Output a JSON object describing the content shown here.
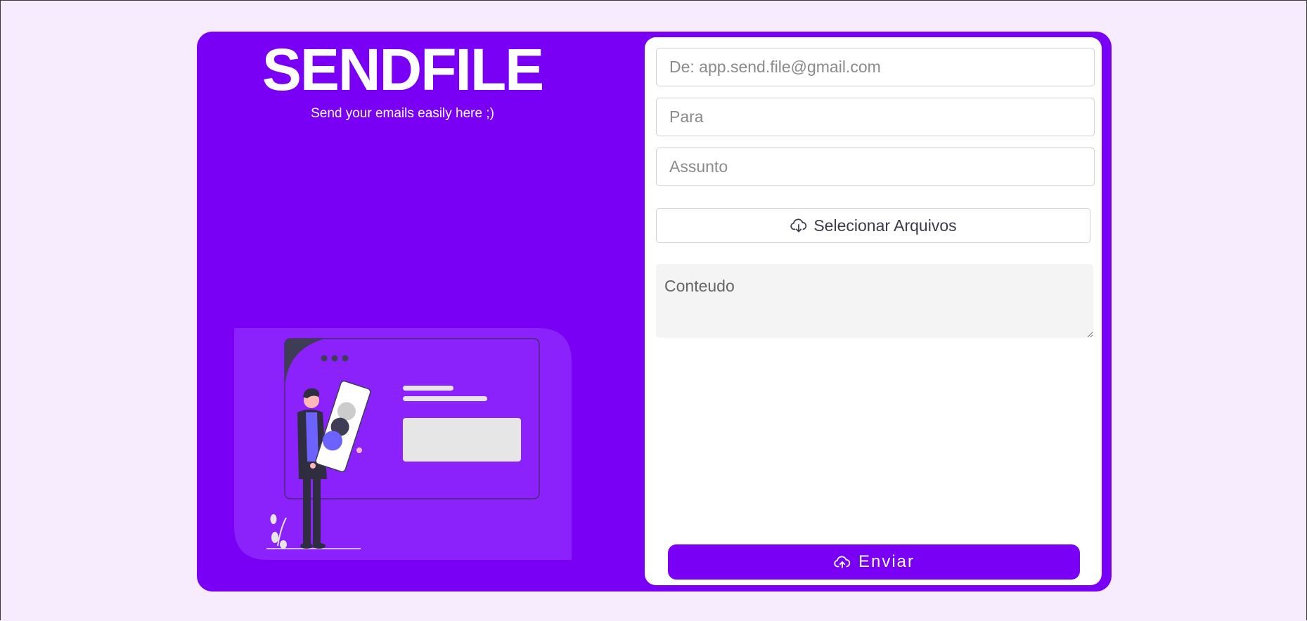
{
  "brand": {
    "title": "SENDFILE",
    "subtitle": "Send your emails easily here ;)"
  },
  "form": {
    "from_placeholder": "De: app.send.file@gmail.com",
    "to_placeholder": "Para",
    "subject_placeholder": "Assunto",
    "select_files_label": "Selecionar Arquivos",
    "content_placeholder": "Conteudo",
    "send_label": "Enviar"
  },
  "icons": {
    "select_files": "cloud-download-icon",
    "send": "cloud-upload-icon"
  },
  "colors": {
    "accent": "#7a00f5",
    "page_background": "#f6ecfd",
    "illustration_panel": "#8b22fb"
  }
}
